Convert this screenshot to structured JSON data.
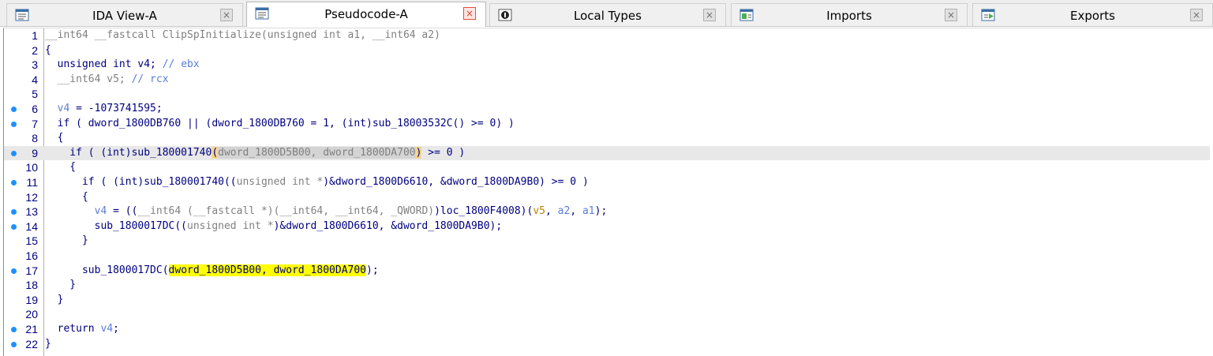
{
  "tabs": [
    {
      "label": "IDA View-A",
      "icon": "ida-view-icon",
      "close": "×",
      "active": false
    },
    {
      "label": "Pseudocode-A",
      "icon": "pseudocode-icon",
      "close": "×",
      "active": true
    },
    {
      "label": "Local Types",
      "icon": "local-types-icon",
      "close": "×",
      "active": false
    },
    {
      "label": "Imports",
      "icon": "imports-icon",
      "close": "×",
      "active": false
    },
    {
      "label": "Exports",
      "icon": "exports-icon",
      "close": "×",
      "active": false
    }
  ],
  "code": {
    "l1": {
      "num": "1",
      "a": "__int64 __fastcall ClipSpInitialize(unsigned int a1, __int64 a2)"
    },
    "l2": {
      "num": "2",
      "a": "{"
    },
    "l3": {
      "num": "3",
      "a": "  unsigned int v4; ",
      "b": "// ebx"
    },
    "l4": {
      "num": "4",
      "a": "  __int64 v5; ",
      "b": "// rcx"
    },
    "l5": {
      "num": "5"
    },
    "l6": {
      "num": "6",
      "a": "  ",
      "b": "v4",
      " c": "",
      "c": " = -1073741595;"
    },
    "l7": {
      "num": "7",
      "a": "  if ( dword_1800DB760 || (dword_1800DB760 = 1, (int)sub_18003532C() >= 0) )"
    },
    "l8": {
      "num": "8",
      "a": "  {"
    },
    "l9": {
      "num": "9",
      "a": "    if ( (int)sub_180001740",
      "b": "(",
      "c": "dword_1800D5B00, dword_1800DA700",
      "d": ")",
      "e": " >= 0 )"
    },
    "l10": {
      "num": "10",
      "a": "    {"
    },
    "l11": {
      "num": "11",
      "a": "      if ( (int)sub_180001740((",
      "b": "unsigned int *",
      "c": ")&dword_1800D6610, &dword_1800DA9B0) >= 0 )"
    },
    "l12": {
      "num": "12",
      "a": "      {"
    },
    "l13": {
      "num": "13",
      "a": "        ",
      "b": "v4",
      "c": " = ((",
      "d": "__int64 (__fastcall *)(__int64, __int64, _QWORD)",
      "e": ")loc_1800F4008)(",
      "f": "v5",
      ",g": "",
      "g": ", ",
      "h": "a2",
      "i": ", ",
      "j": "a1",
      "k": ");"
    },
    "l14": {
      "num": "14",
      "a": "        sub_1800017DC((",
      "b": "unsigned int *",
      "c": ")&dword_1800D6610, &dword_1800DA9B0);"
    },
    "l15": {
      "num": "15",
      "a": "      }"
    },
    "l16": {
      "num": "16"
    },
    "l17": {
      "num": "17",
      "a": "      sub_1800017DC(",
      "b": "dword_1800D5B00, dword_1800DA700",
      "c": ");"
    },
    "l18": {
      "num": "18",
      "a": "    }"
    },
    "l19": {
      "num": "19",
      "a": "  }"
    },
    "l20": {
      "num": "20"
    },
    "l21": {
      "num": "21",
      "a": "  return ",
      "b": "v4",
      "c": ";"
    },
    "l22": {
      "num": "22",
      "a": "}"
    }
  }
}
